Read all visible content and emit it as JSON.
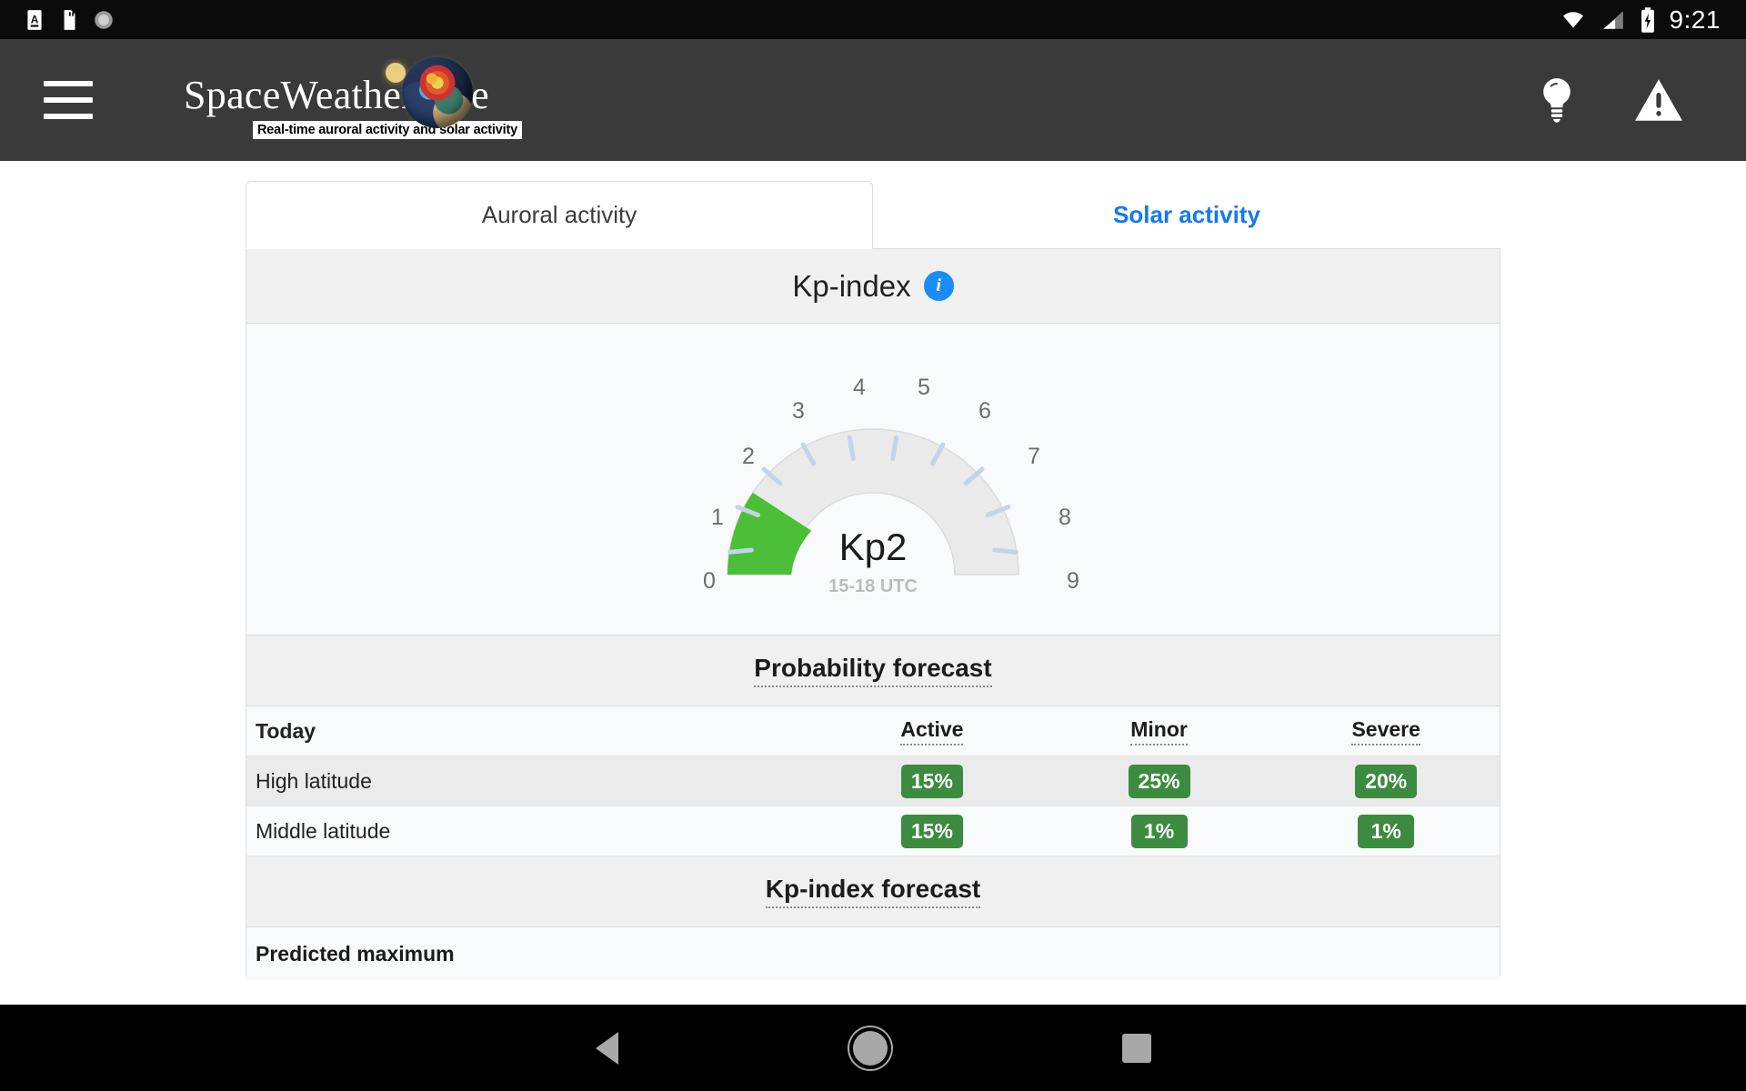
{
  "statusbar": {
    "clock": "9:21",
    "left_icons": [
      "app-notification-icon",
      "sd-card-icon",
      "loading-spinner-icon"
    ],
    "right_icons": [
      "wifi-icon",
      "cellular-signal-icon",
      "battery-charging-icon"
    ]
  },
  "appbar": {
    "menu_icon": "hamburger-menu-icon",
    "logo_text": "SpaceWeatherLive",
    "logo_tagline": "Real-time auroral activity and solar activity",
    "lightbulb_icon": "lightbulb-icon",
    "alert_icon": "warning-triangle-icon"
  },
  "tabs": [
    {
      "label": "Auroral activity",
      "active": true
    },
    {
      "label": "Solar activity",
      "active": false
    }
  ],
  "card": {
    "title": "Kp-index",
    "info_icon_label": "i"
  },
  "gauge": {
    "value_text": "Kp2",
    "sub_text": "15-18 UTC",
    "tick_labels": [
      "0",
      "1",
      "2",
      "3",
      "4",
      "5",
      "6",
      "7",
      "8",
      "9"
    ],
    "fill_color": "#4cbf38",
    "track_color": "#eaeaea",
    "tick_color": "#c3d4ea"
  },
  "probability": {
    "section_title": "Probability forecast",
    "headers": [
      "Today",
      "Active",
      "Minor",
      "Severe"
    ],
    "rows": [
      {
        "name": "High latitude",
        "active": "15%",
        "minor": "25%",
        "severe": "20%"
      },
      {
        "name": "Middle latitude",
        "active": "15%",
        "minor": "1%",
        "severe": "1%"
      }
    ]
  },
  "forecast": {
    "section_title": "Kp-index forecast",
    "predicted_maximum_label": "Predicted maximum"
  },
  "navbar": {
    "back": "back-triangle-icon",
    "home": "home-circle-icon",
    "recents": "recents-square-icon"
  },
  "chart_data": {
    "type": "gauge",
    "title": "Kp-index",
    "value": 2,
    "value_label": "Kp2",
    "period": "15-18 UTC",
    "range": [
      0,
      9
    ],
    "ticks": [
      0,
      1,
      2,
      3,
      4,
      5,
      6,
      7,
      8,
      9
    ],
    "filled_segment": [
      0,
      2
    ],
    "fill_color": "#4cbf38",
    "track_color": "#eaeaea"
  }
}
